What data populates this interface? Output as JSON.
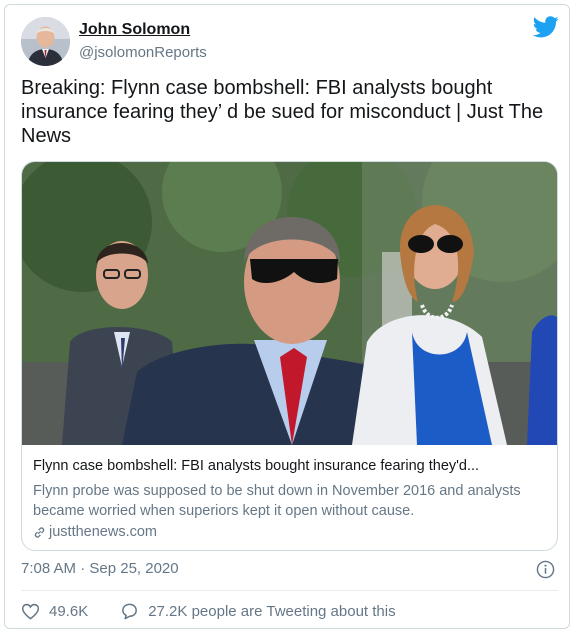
{
  "author": {
    "name": "John Solomon",
    "handle": "@jsolomonReports"
  },
  "tweet": {
    "text": "Breaking: Flynn case bombshell: FBI analysts bought insurance fearing they’ d be sued for misconduct | Just The News"
  },
  "card": {
    "title": "Flynn case bombshell: FBI analysts bought insurance fearing they'd...",
    "description": "Flynn probe was supposed to be shut down in November 2016 and analysts became worried when superiors kept it open without cause.",
    "domain": "justthenews.com"
  },
  "meta": {
    "timestamp": "7:08 AM · Sep 25, 2020"
  },
  "actions": {
    "likes": "49.6K",
    "tweeting": "27.2K people are Tweeting about this"
  },
  "colors": {
    "twitter_blue": "#1da1f2",
    "secondary_text": "#657786",
    "border": "#cfd9de"
  },
  "icons": [
    "twitter-bird-icon",
    "link-icon",
    "info-icon",
    "heart-icon",
    "speech-bubble-icon"
  ]
}
